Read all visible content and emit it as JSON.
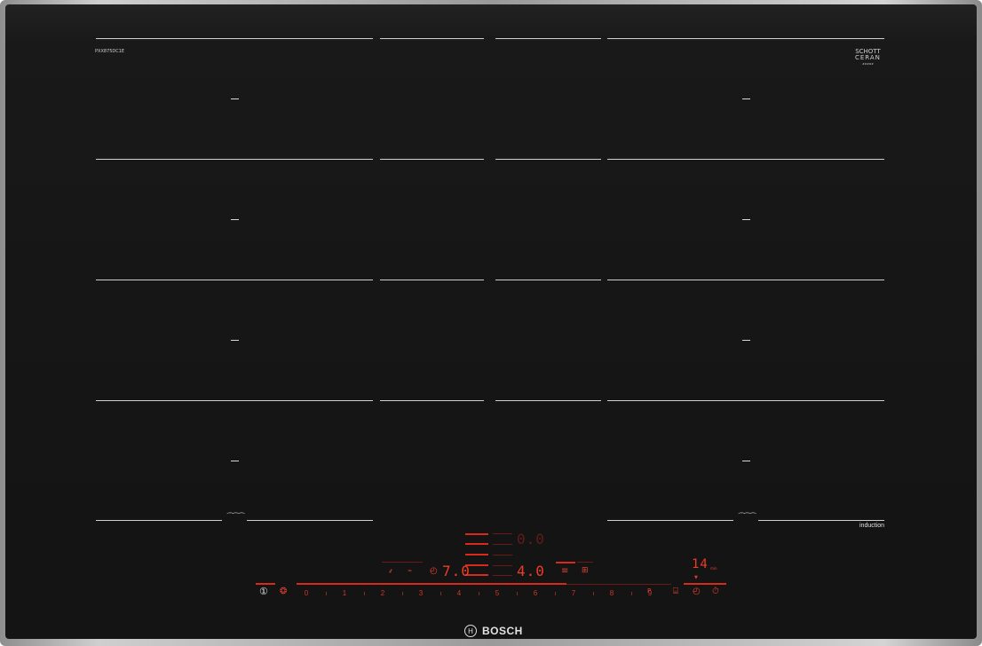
{
  "cooktop": {
    "model_label": "PXX875DC1E",
    "glass_brand": {
      "line1": "SCHOTT",
      "line2": "CERAN",
      "line3": "#####"
    },
    "induction_label": "induction",
    "flex_symbol": "⁀⁀⁀",
    "zone_dash": "–"
  },
  "displays": {
    "top_readout": "0.0",
    "left_power": "7.0",
    "center_power": "4.0",
    "timer_readout": "14",
    "timer_unit": "min"
  },
  "slider": {
    "scale": [
      "0",
      "1",
      "2",
      "3",
      "4",
      "5",
      "6",
      "7",
      "8",
      "9"
    ],
    "boost_label": "P"
  },
  "brand": {
    "name": "BOSCH",
    "logo_glyph": "H"
  },
  "colors": {
    "glass": "#151515",
    "frame": "#b5b5b5",
    "indicator_red": "#e43322",
    "zone_marking": "#cfcfcf"
  }
}
